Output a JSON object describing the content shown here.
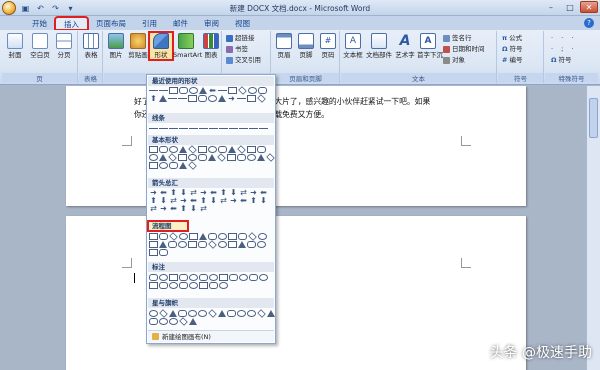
{
  "window": {
    "title": "新建 DOCX 文档.docx - Microsoft Word",
    "quick_access": [
      "save-icon",
      "undo-icon",
      "redo-icon"
    ]
  },
  "tabs": [
    "开始",
    "插入",
    "页面布局",
    "引用",
    "邮件",
    "审阅",
    "视图"
  ],
  "active_tab": "插入",
  "ribbon": {
    "pages": {
      "label": "页",
      "buttons": [
        "封面",
        "空白页",
        "分页"
      ]
    },
    "table": {
      "label": "表格",
      "buttons": [
        "表格"
      ]
    },
    "illustrations": {
      "label": "插图",
      "buttons": [
        "图片",
        "剪贴画",
        "形状",
        "SmartArt",
        "图表"
      ]
    },
    "links": {
      "label": "链接",
      "items": [
        "超链接",
        "书签",
        "交叉引用"
      ]
    },
    "header_footer": {
      "label": "页眉和页脚",
      "buttons": [
        "页眉",
        "页脚",
        "页码"
      ]
    },
    "text": {
      "label": "文本",
      "buttons": [
        "文本框",
        "文档部件",
        "艺术字",
        "首字下沉"
      ],
      "items": [
        "签名行",
        "日期和时间",
        "对象"
      ]
    },
    "symbols": {
      "label": "符号",
      "items": [
        "公式",
        "符号",
        "编号"
      ]
    },
    "special": {
      "label": "特殊符号",
      "items": [
        "符号"
      ]
    }
  },
  "document": {
    "line1": "好了，通过以上的步骤就可以制作出特效大片了，感兴趣的小伙伴赶紧试一下吧。如果",
    "line2": "你还想了解下载更多剪辑，可以来本站下载免费又方便。"
  },
  "shapes_menu": {
    "sections": [
      "最近使用的形状",
      "线条",
      "基本形状",
      "箭头总汇",
      "流程图",
      "标注",
      "星与旗帜"
    ],
    "highlighted_section": "流程图",
    "new_canvas": "新建绘图画布(N)"
  },
  "watermark": "头条 @极速手助",
  "colors": {
    "highlight": "#e02020",
    "ribbon": "#dbe6f4",
    "accent": "#15428b"
  }
}
